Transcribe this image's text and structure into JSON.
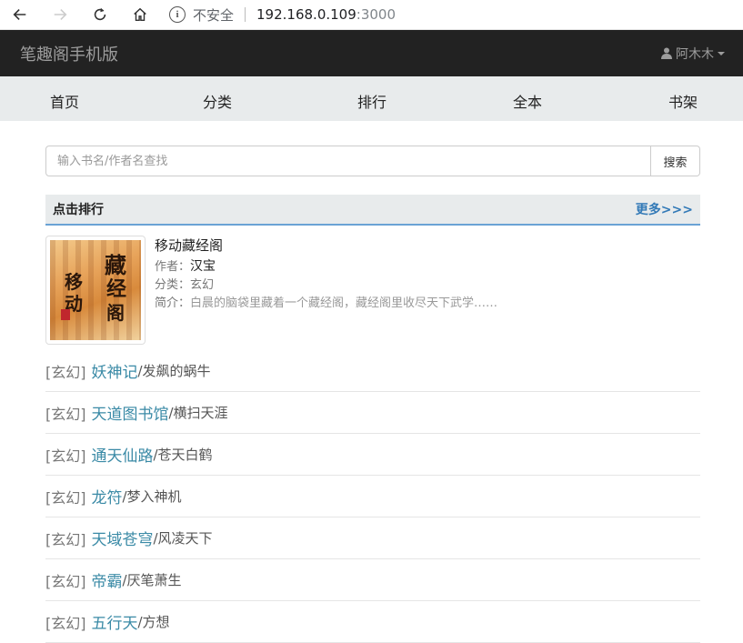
{
  "browser": {
    "insecure_label": "不安全",
    "host": "192.168.0.109",
    "port": ":3000"
  },
  "header": {
    "brand": "笔趣阁手机版",
    "user": "阿木木"
  },
  "nav": {
    "items": [
      {
        "label": "首页"
      },
      {
        "label": "分类"
      },
      {
        "label": "排行"
      },
      {
        "label": "全本"
      },
      {
        "label": "书架"
      }
    ]
  },
  "search": {
    "placeholder": "输入书名/作者名查找",
    "button": "搜索"
  },
  "ranking": {
    "title": "点击排行",
    "more": "更多>>>",
    "featured": {
      "title": "移动藏经阁",
      "author_label": "作者：",
      "author": "汉宝",
      "category_label": "分类：",
      "category": "玄幻",
      "intro_label": "简介：",
      "intro": "白晨的脑袋里藏着一个藏经阁，藏经阁里收尽天下武学……",
      "cover_text": [
        "移",
        "动",
        "藏",
        "经",
        "阁"
      ]
    },
    "list": [
      {
        "category": "[玄幻]",
        "title": "妖神记",
        "author": "/发飙的蜗牛"
      },
      {
        "category": "[玄幻]",
        "title": "天道图书馆",
        "author": "/横扫天涯"
      },
      {
        "category": "[玄幻]",
        "title": "通天仙路",
        "author": "/苍天白鹤"
      },
      {
        "category": "[玄幻]",
        "title": "龙符",
        "author": "/梦入神机"
      },
      {
        "category": "[玄幻]",
        "title": "天域苍穹",
        "author": "/风凌天下"
      },
      {
        "category": "[玄幻]",
        "title": "帝霸",
        "author": "/厌笔萧生"
      },
      {
        "category": "[玄幻]",
        "title": "五行天",
        "author": "/方想"
      }
    ]
  },
  "colors": {
    "header_bg": "#222222",
    "nav_bg": "#e8ebec",
    "link": "#3a8aa6",
    "accent_line": "#6aa3d5"
  }
}
